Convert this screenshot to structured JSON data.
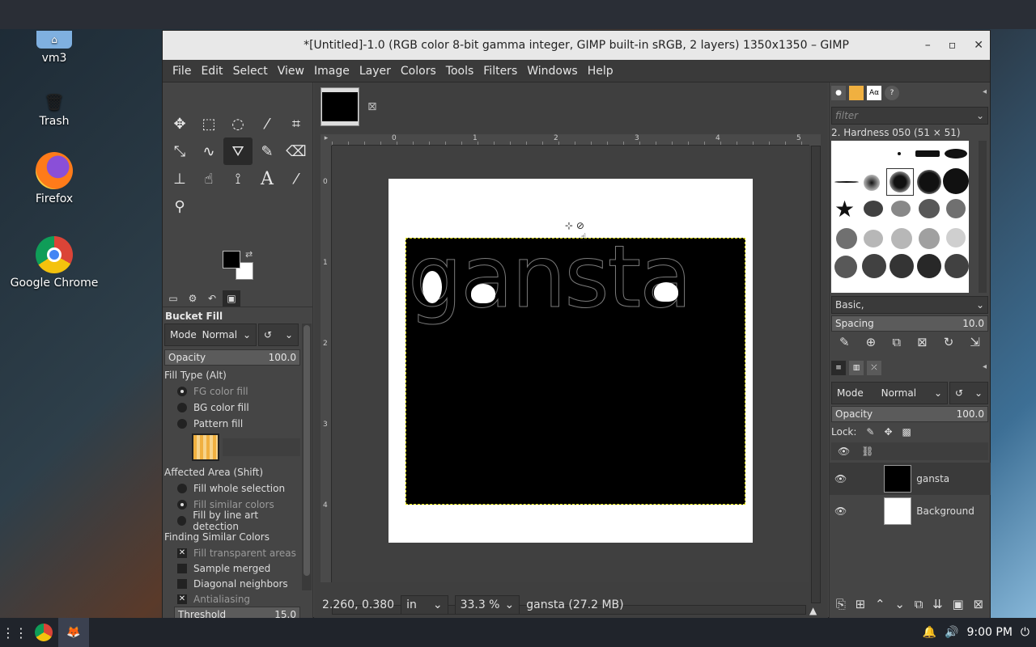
{
  "desktop": {
    "icons": [
      {
        "label": "vm3",
        "icon": "home-folder-icon"
      },
      {
        "label": "Trash",
        "icon": "trash-icon"
      },
      {
        "label": "Firefox",
        "icon": "firefox-icon"
      },
      {
        "label": "Google Chrome",
        "icon": "chrome-icon"
      }
    ]
  },
  "window": {
    "title": "*[Untitled]-1.0 (RGB color 8-bit gamma integer, GIMP built-in sRGB, 2 layers) 1350x1350 – GIMP",
    "menu": [
      "File",
      "Edit",
      "Select",
      "View",
      "Image",
      "Layer",
      "Colors",
      "Tools",
      "Filters",
      "Windows",
      "Help"
    ]
  },
  "tool_options": {
    "title": "Bucket Fill",
    "mode_label": "Mode",
    "mode_value": "Normal",
    "opacity_label": "Opacity",
    "opacity_value": "100.0",
    "fill_type_label": "Fill Type  (Alt)",
    "fill_fg": "FG color fill",
    "fill_bg": "BG color fill",
    "fill_pattern": "Pattern fill",
    "affected_label": "Affected Area  (Shift)",
    "aff_whole": "Fill whole selection",
    "aff_similar": "Fill similar colors",
    "aff_lineart": "Fill by line art detection",
    "similar_label": "Finding Similar Colors",
    "fill_transparent": "Fill transparent areas",
    "sample_merged": "Sample merged",
    "diagonal": "Diagonal neighbors",
    "antialiasing": "Antialiasing",
    "threshold_label": "Threshold",
    "threshold_value": "15.0"
  },
  "canvas": {
    "layer_text": "gansta",
    "ruler_h": [
      "0",
      "1",
      "2",
      "3",
      "4",
      "5"
    ],
    "ruler_v": [
      "0",
      "1",
      "2",
      "3",
      "4"
    ]
  },
  "status": {
    "coords": "2.260, 0.380",
    "unit": "in",
    "zoom": "33.3 %",
    "info": "gansta (27.2 MB)"
  },
  "brushes": {
    "filter_placeholder": "filter",
    "selected": "2. Hardness 050 (51 × 51)",
    "preset": "Basic,",
    "spacing_label": "Spacing",
    "spacing_value": "10.0"
  },
  "layers": {
    "mode_label": "Mode",
    "mode_value": "Normal",
    "opacity_label": "Opacity",
    "opacity_value": "100.0",
    "lock_label": "Lock:",
    "items": [
      {
        "name": "gansta"
      },
      {
        "name": "Background"
      }
    ]
  },
  "taskbar": {
    "time": "9:00 PM"
  }
}
